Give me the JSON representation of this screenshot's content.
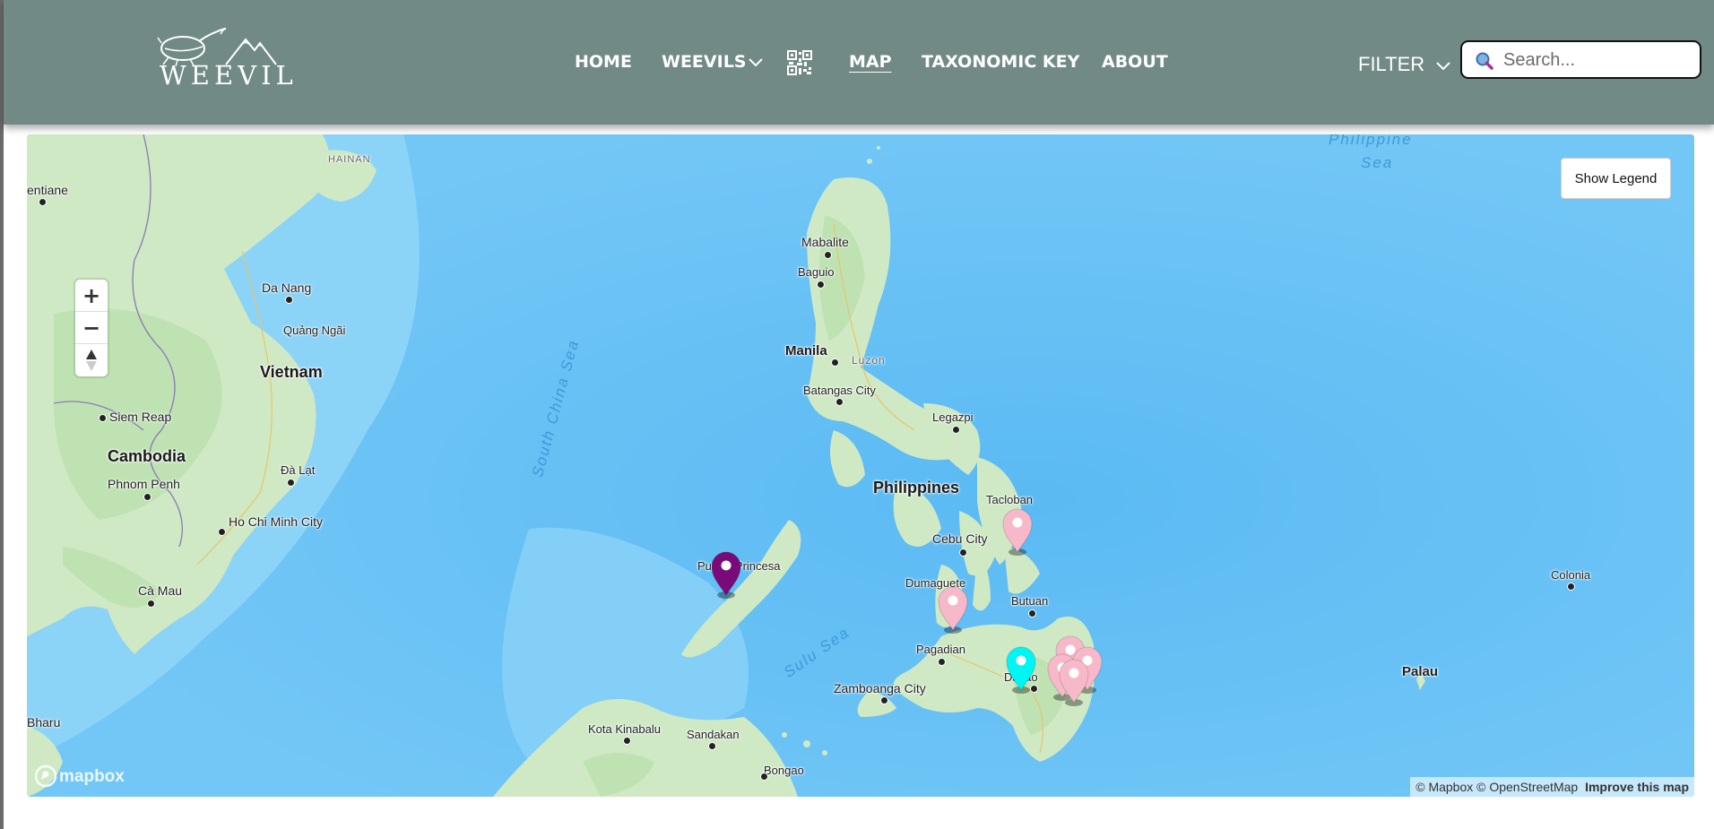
{
  "brand": {
    "logo_text": "WEEVIL"
  },
  "nav": {
    "home": "HOME",
    "weevils": "WEEVILS",
    "map": "MAP",
    "taxonomic_key": "TAXONOMIC KEY",
    "about": "ABOUT",
    "qr_icon": "qr-code-icon"
  },
  "filter": {
    "label": "FILTER"
  },
  "search": {
    "placeholder": "Search...",
    "value": ""
  },
  "colors": {
    "navbar": "#718a85",
    "sea": "#6cc3f5",
    "land": "#cde8c2",
    "marker_pink": "#f7b8c9",
    "marker_cyan": "#00f5f5",
    "marker_purple": "#7a0a7a"
  },
  "map": {
    "legend_button": "Show Legend",
    "zoom_in": "+",
    "zoom_out": "−",
    "mapbox_logo": "mapbox",
    "attribution": {
      "mapbox": "© Mapbox",
      "osm": "© OpenStreetMap",
      "improve": "Improve this map"
    },
    "places": {
      "hainan": "HAINAN",
      "vientiane": "entiane",
      "da_nang": "Da Nang",
      "quang_ngai": "Quảng Ngãi",
      "vietnam": "Vietnam",
      "siem_reap": "Siem Reap",
      "cambodia": "Cambodia",
      "phnom_penh": "Phnom Penh",
      "da_lat": "Đà Lạt",
      "ho_chi_minh": "Ho Chi Minh City",
      "ca_mau": "Cà Mau",
      "bharu": "Bharu",
      "south_china_sea": "South China Sea",
      "philippine_sea": "Philippine",
      "philippine_sea_2": "Sea",
      "mabalite": "Mabalite",
      "baguio": "Baguio",
      "manila": "Manila",
      "luzon": "Luzon",
      "batangas": "Batangas City",
      "legazpi": "Legazpi",
      "philippines": "Philippines",
      "tacloban": "Tacloban",
      "cebu": "Cebu City",
      "dumaguete": "Dumaguete",
      "puerto_princesa": "Puerto Princesa",
      "sulu_sea": "Sulu Sea",
      "butuan": "Butuan",
      "pagadian": "Pagadian",
      "zamboanga": "Zamboanga City",
      "davao": "Davao",
      "kota_kinabalu": "Kota Kinabalu",
      "sandakan": "Sandakan",
      "bongao": "Bongao",
      "colonia": "Colonia",
      "palau": "Palau"
    },
    "markers": [
      {
        "name": "specimen-marker-palawan",
        "color": "#7a0a7a"
      },
      {
        "name": "specimen-marker-leyte",
        "color": "#f7b8c9"
      },
      {
        "name": "specimen-marker-negros",
        "color": "#f7b8c9"
      },
      {
        "name": "specimen-marker-davao",
        "color": "#00f5f5"
      },
      {
        "name": "specimen-marker-davao-oriental-1",
        "color": "#f7b8c9"
      },
      {
        "name": "specimen-marker-davao-oriental-2",
        "color": "#f7b8c9"
      },
      {
        "name": "specimen-marker-davao-oriental-3",
        "color": "#f7b8c9"
      },
      {
        "name": "specimen-marker-davao-oriental-4",
        "color": "#f7b8c9"
      }
    ]
  }
}
